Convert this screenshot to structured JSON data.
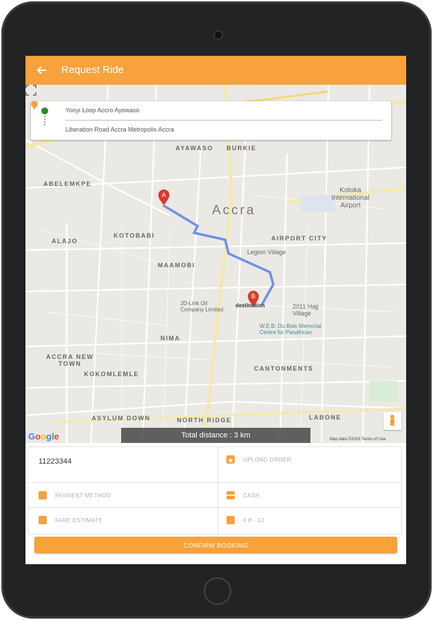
{
  "appbar": {
    "title": "Request Ride",
    "back_icon": "arrow-left-icon"
  },
  "route": {
    "from": "Yooyi Loop Accro Ayowaso",
    "to": "Liberation Road Accra Metropolis Accra"
  },
  "map": {
    "labels": {
      "ayawaso": "AYAWASO",
      "burkie": "BURKIE",
      "abelemkpe": "ABELEMKPE",
      "accra": "Accra",
      "kotobabi": "KOTOBABI",
      "alajo": "ALAJO",
      "airport_city": "AIRPORT CITY",
      "legion_village": "Legion Village",
      "maamobi": "MAAMOBI",
      "kotoka": "Kotoka\nInternational\nAirport",
      "jd_link": "JD-Link Oil\nCompany Limited",
      "destination": "destination",
      "haj_village": "2011 Hajj\nVillage",
      "webdubois": "W.E.B. Du Bois Memorial\nCentre for Panafrican",
      "nima": "NIMA",
      "accra_new_town": "ACCRA NEW\nTOWN",
      "kokomlemle": "KOKOMLEMLE",
      "cantonments": "CANTONMENTS",
      "asylum_down": "ASYLUM DOWN",
      "north_ridge": "NORTH RIDGE",
      "labone": "LABONE"
    },
    "marker_a": "A",
    "marker_b": "B",
    "google": "Google",
    "attribution": "Map data ©2019    Terms of Use",
    "distance": "Total distance : 3 km"
  },
  "form": {
    "order_number": "11223344",
    "upload_order": "UPLOAD ORDER",
    "payment_method": "PAYMENT METHOD",
    "payment_value": "CASH",
    "fare_estimate": "FARE ESTIMATE",
    "fare_value": "¢ 8 - 12"
  },
  "confirm_label": "CONFIRM BOOKING",
  "colors": {
    "accent": "#f7a23b",
    "route": "#6f8fe8",
    "marker": "#d93a2e"
  }
}
